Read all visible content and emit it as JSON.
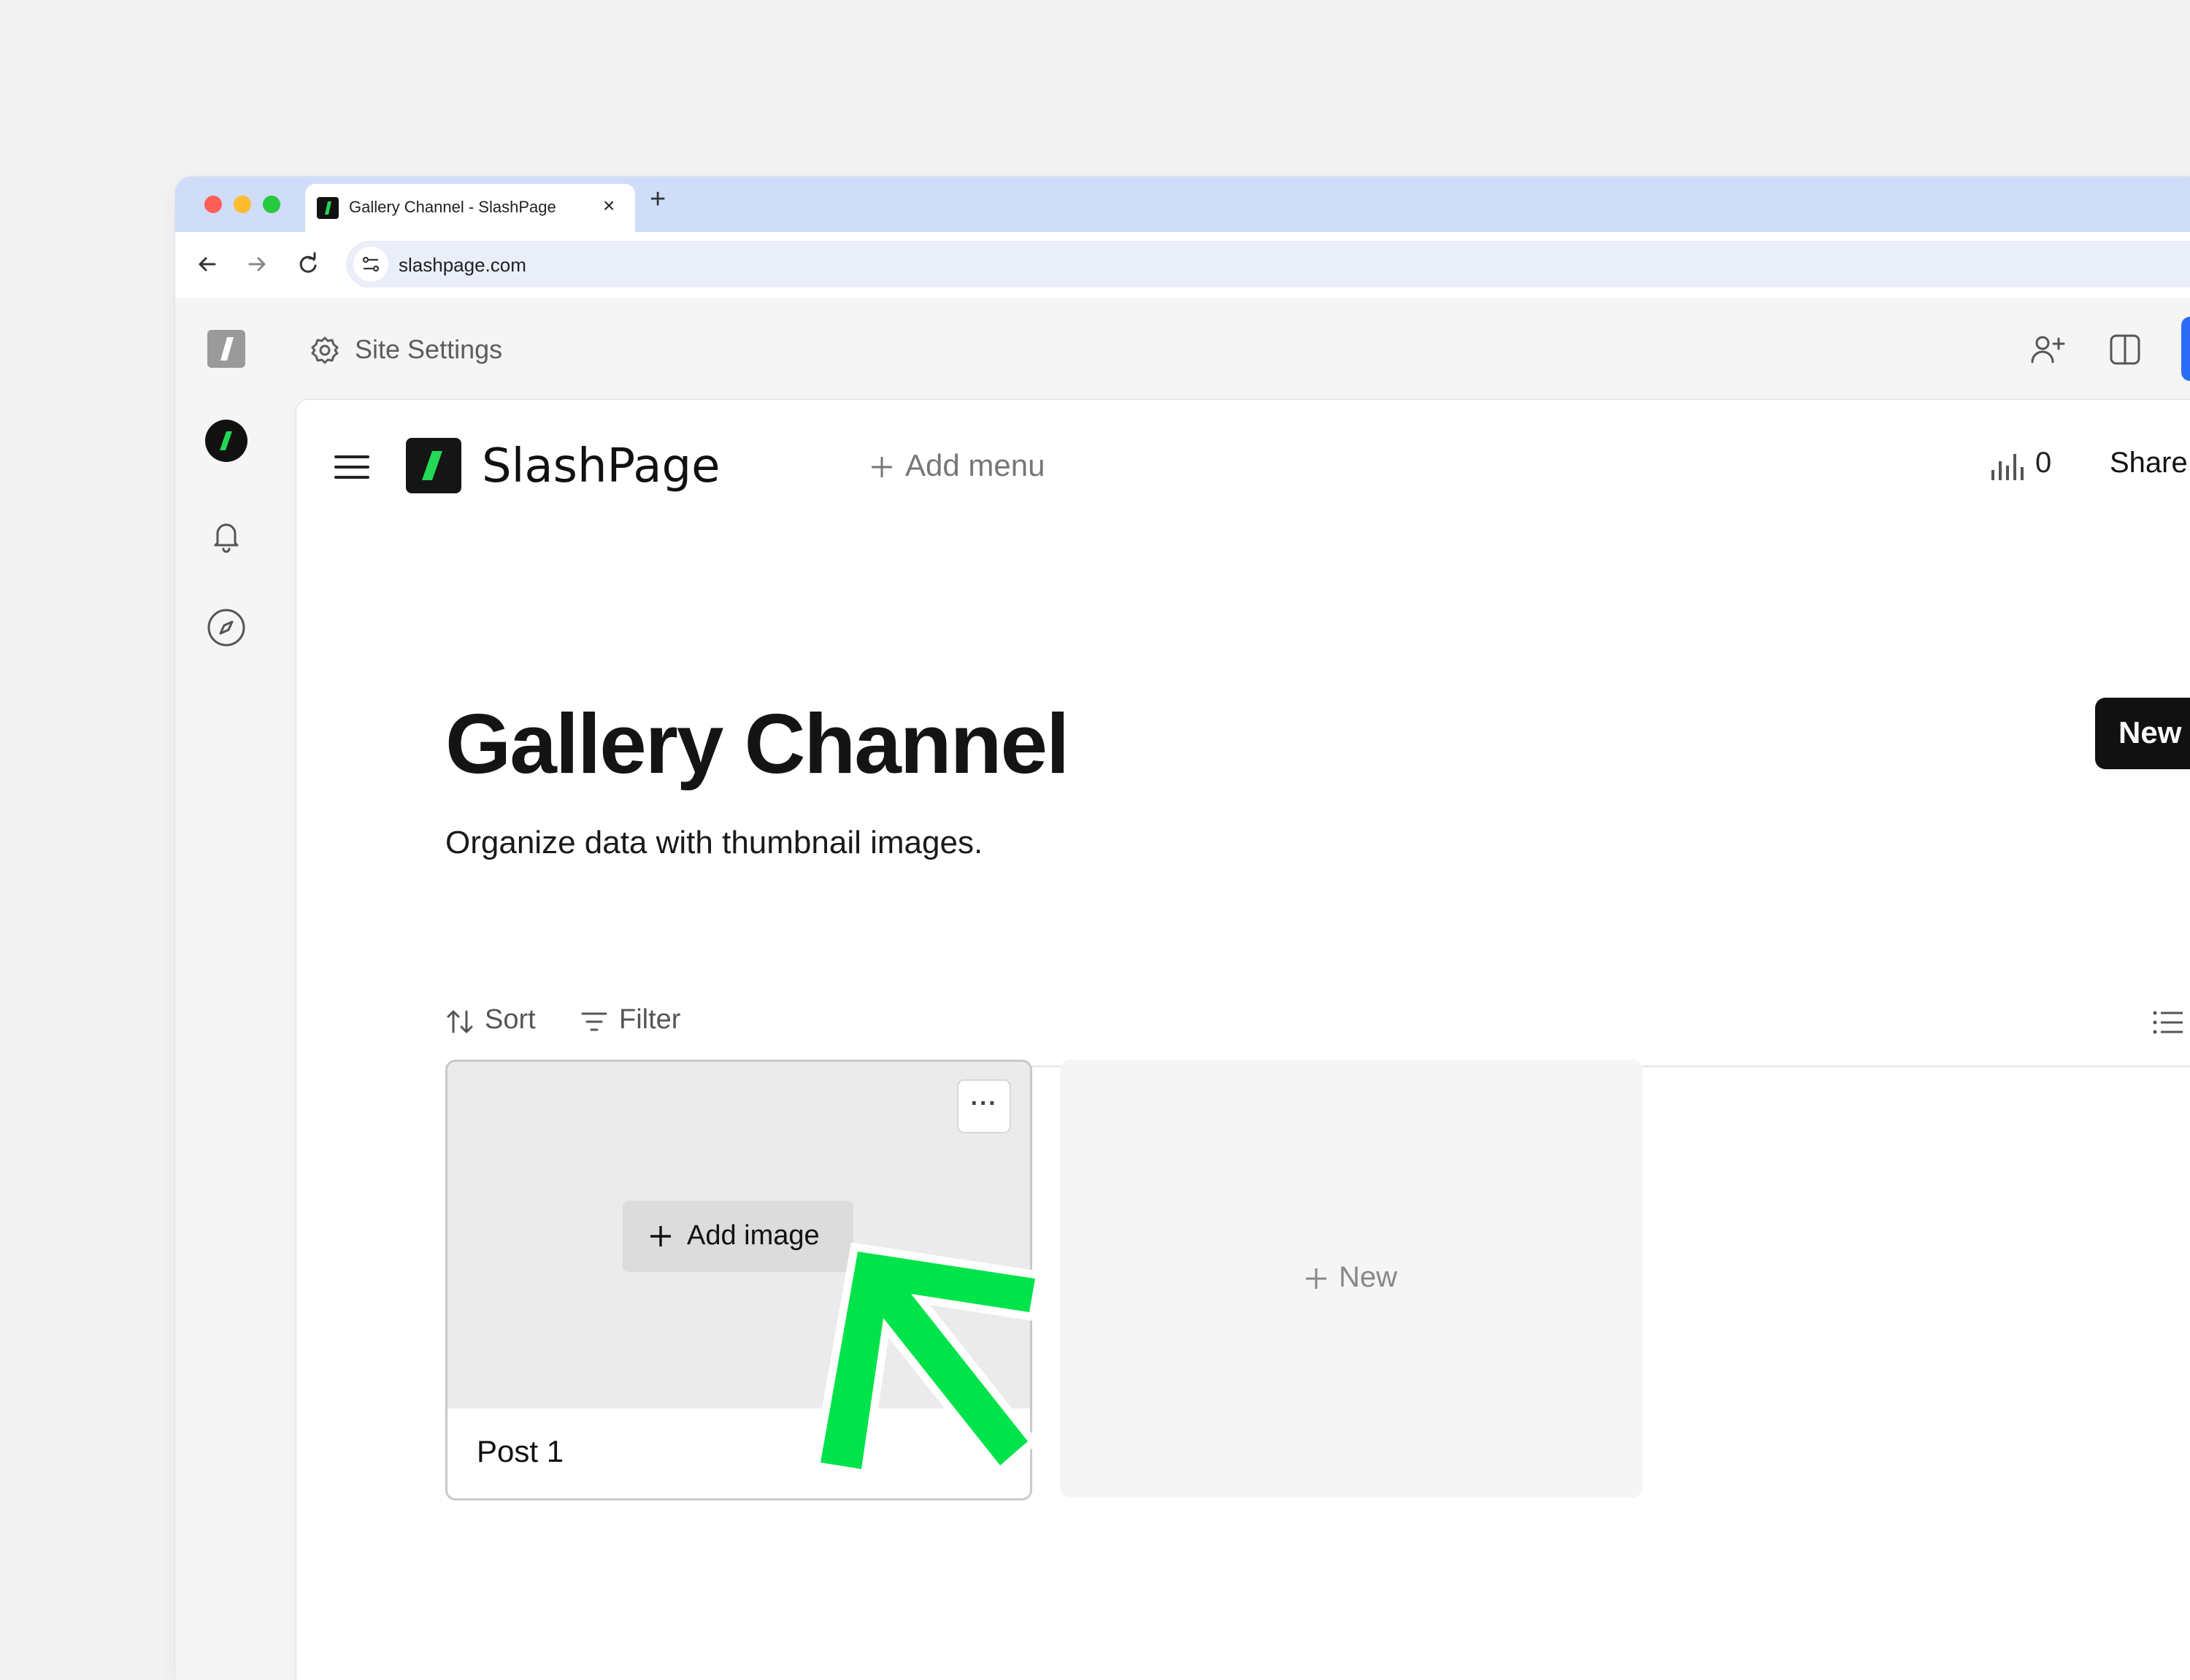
{
  "browser": {
    "tab_title": "Gallery Channel - SlashPage",
    "tab_close": "×",
    "new_tab": "+",
    "url": "slashpage.com"
  },
  "app": {
    "site_settings_label": "Site Settings"
  },
  "page": {
    "site_name": "SlashPage",
    "add_menu_label": "Add menu",
    "stats_count": "0",
    "share_label": "Share",
    "title": "Gallery Channel",
    "description": "Organize data with thumbnail images.",
    "new_button_label": "New",
    "sort_label": "Sort",
    "filter_label": "Filter"
  },
  "gallery": {
    "cards": [
      {
        "title": "Post 1",
        "add_image_label": "Add image",
        "more_label": "···"
      }
    ],
    "new_card_label": "New"
  },
  "colors": {
    "brand_green": "#22d855",
    "arrow_green": "#00e34a",
    "tab_strip": "#cfddf9",
    "dark": "#111111"
  },
  "icons": [
    "hamburger-icon",
    "slashpage-logo-icon",
    "plus-icon",
    "bar-chart-icon",
    "sort-icon",
    "filter-icon",
    "list-view-icon",
    "gear-icon",
    "bell-icon",
    "compass-icon",
    "add-user-icon",
    "split-view-icon",
    "back-icon",
    "forward-icon",
    "reload-icon",
    "site-info-icon",
    "zoom-icon",
    "ellipsis-icon",
    "annotation-arrow-icon"
  ]
}
